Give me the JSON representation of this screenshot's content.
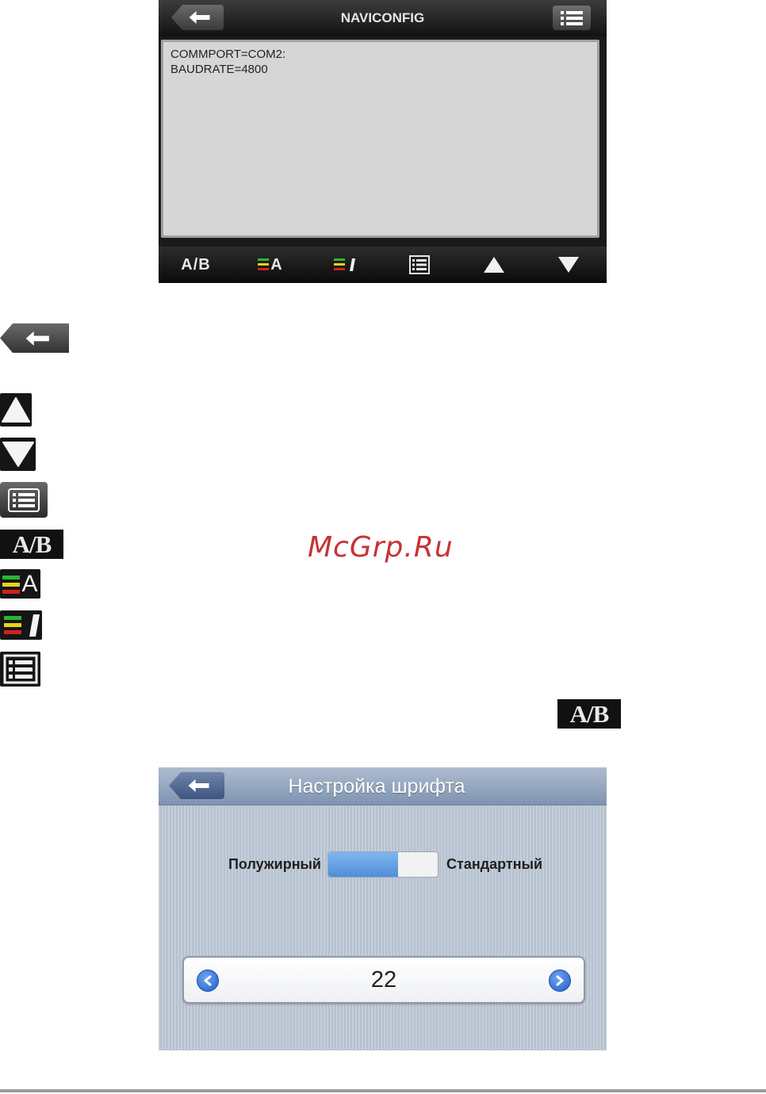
{
  "screen1": {
    "title": "NAVICONFIG",
    "textarea_lines": [
      "COMMPORT=COM2:",
      "BAUDRATE=4800"
    ],
    "toolbar": [
      {
        "label": "A/B",
        "icon": "font-toggle-icon"
      },
      {
        "label": "A",
        "icon": "font-style-icon"
      },
      {
        "label": "",
        "icon": "italic-style-icon"
      },
      {
        "label": "",
        "icon": "list-icon"
      },
      {
        "label": "",
        "icon": "arrow-up-icon"
      },
      {
        "label": "",
        "icon": "arrow-down-icon"
      }
    ]
  },
  "legend": {
    "icons": [
      "back-arrow-icon",
      "arrow-up-icon",
      "arrow-down-icon",
      "menu-icon",
      "font-toggle-icon",
      "font-style-icon",
      "italic-style-icon",
      "list-icon"
    ],
    "ab_label": "A/B",
    "font_letter": "A"
  },
  "watermark": "McGrp.Ru",
  "screen2": {
    "title": "Настройка шрифта",
    "bold_label": "Полужирный",
    "standard_label": "Стандартный",
    "toggle_fraction": 0.64,
    "font_size_value": "22"
  },
  "colors": {
    "accent_blue": "#4f8fd8",
    "header_dark": "#121212",
    "watermark_red": "#c83232",
    "font_green": "#2fb52f",
    "font_yellow": "#e8d21c",
    "font_red": "#d02020"
  }
}
